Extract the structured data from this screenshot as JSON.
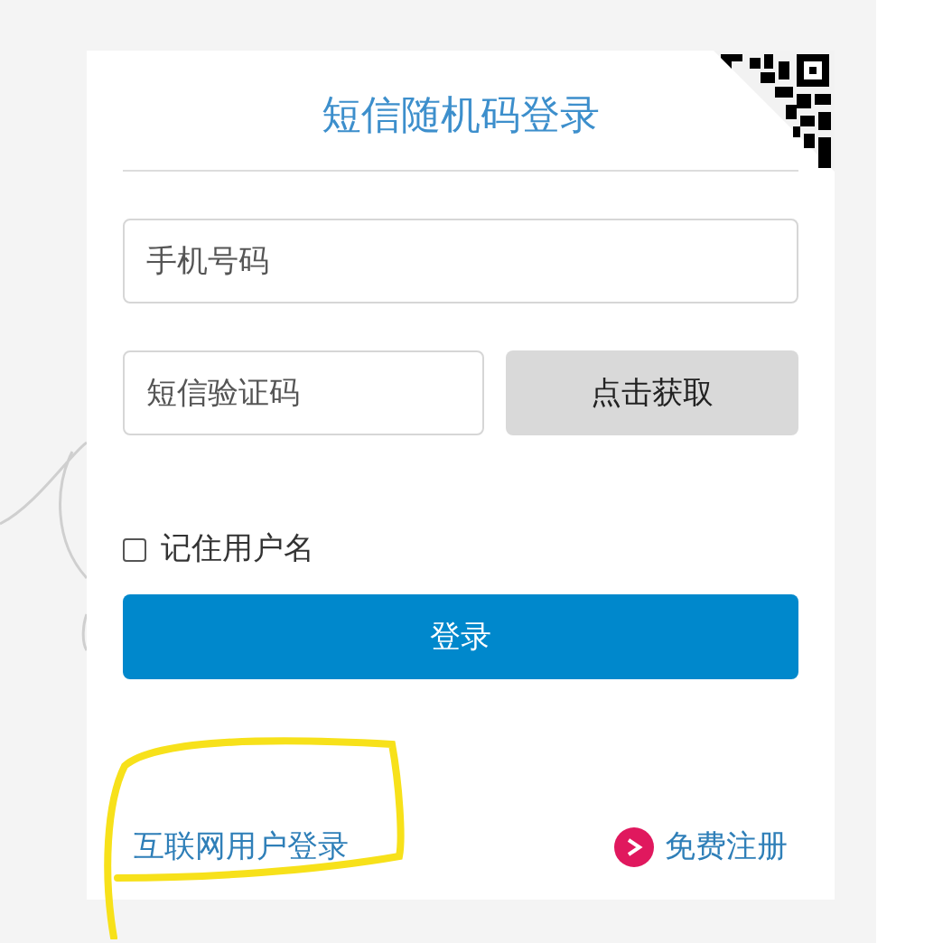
{
  "title": "短信随机码登录",
  "phone_field": {
    "placeholder": "手机号码"
  },
  "code_field": {
    "placeholder": "短信验证码"
  },
  "get_code_button": "点击获取",
  "remember": {
    "label": "记住用户名",
    "checked": false
  },
  "login_button": "登录",
  "internet_login_link": "互联网用户登录",
  "register_link": "免费注册"
}
